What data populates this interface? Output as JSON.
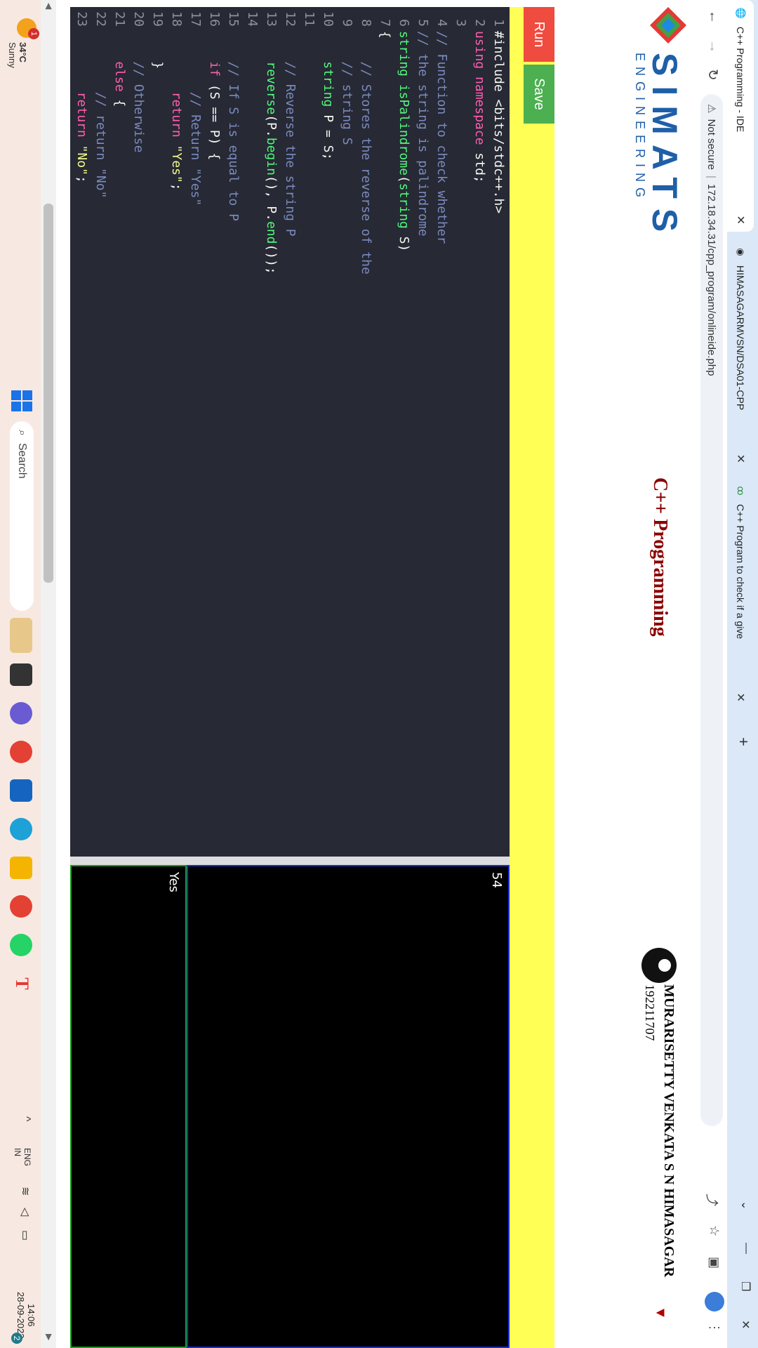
{
  "browser": {
    "tabs": [
      {
        "title": "C++ Programming - IDE",
        "active": true
      },
      {
        "title": "HIMASAGARMVSN/DSA01-CPP",
        "active": false
      },
      {
        "title": "C++ Program to check if a give",
        "active": false
      }
    ],
    "new_tab": "+",
    "url_security": "Not secure",
    "url": "172.18.34.31/cpp_program/onlineide.php"
  },
  "page": {
    "brand": "SIMATS",
    "brand_sub": "ENGINEERING",
    "course_title": "C++ Programming",
    "user_name": "MURARISETTY VENKATA S N HIMASAGAR",
    "user_id": "192211707"
  },
  "ide": {
    "run_label": "Run",
    "save_label": "Save",
    "code_lines": [
      "1",
      "2",
      "3",
      "4",
      "5",
      "6",
      "7",
      "8",
      "9",
      "10",
      "11",
      "12",
      "13",
      "14",
      "15",
      "16",
      "17",
      "18",
      "19",
      "20",
      "21",
      "22",
      "23"
    ],
    "input_value": "54",
    "output_value": "Yes"
  },
  "taskbar": {
    "temperature": "34°C",
    "weather": "Sunny",
    "weather_badge": "1",
    "search_label": "Search",
    "lang": "ENG",
    "region": "IN",
    "time": "14:06",
    "date": "28-09-2023",
    "notif_count": "2"
  },
  "colors": {
    "run": "#ef4b3f",
    "save": "#4caf50",
    "bar": "#ffff55",
    "editor_bg": "#272935",
    "course_title": "#8b0000",
    "brand": "#1f5fa8"
  }
}
